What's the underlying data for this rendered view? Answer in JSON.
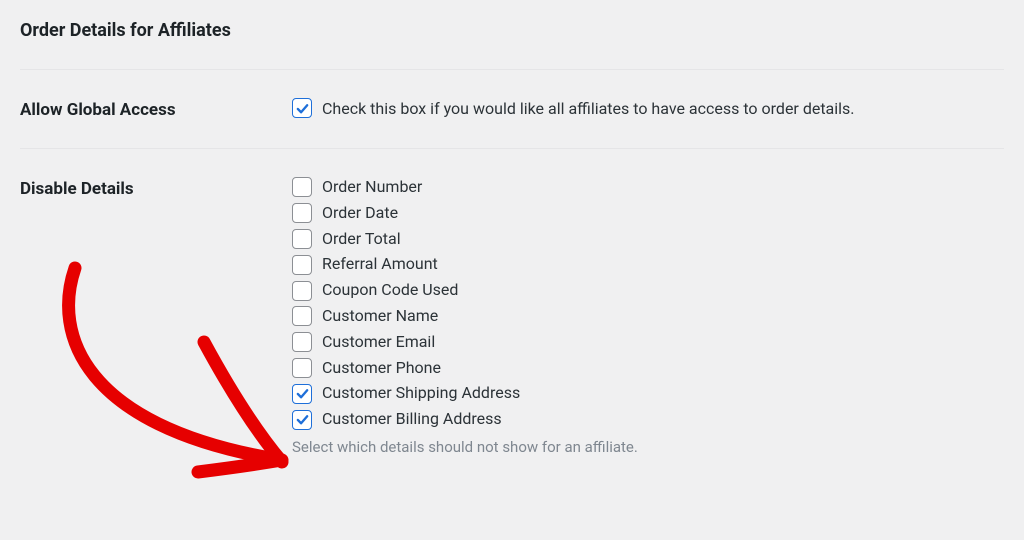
{
  "section_title": "Order Details for Affiliates",
  "allow_global": {
    "label": "Allow Global Access",
    "checked": true,
    "description": "Check this box if you would like all affiliates to have access to order details."
  },
  "disable_details": {
    "label": "Disable Details",
    "help": "Select which details should not show for an affiliate.",
    "options": [
      {
        "name": "order-number",
        "label": "Order Number",
        "checked": false
      },
      {
        "name": "order-date",
        "label": "Order Date",
        "checked": false
      },
      {
        "name": "order-total",
        "label": "Order Total",
        "checked": false
      },
      {
        "name": "referral-amount",
        "label": "Referral Amount",
        "checked": false
      },
      {
        "name": "coupon-code-used",
        "label": "Coupon Code Used",
        "checked": false
      },
      {
        "name": "customer-name",
        "label": "Customer Name",
        "checked": false
      },
      {
        "name": "customer-email",
        "label": "Customer Email",
        "checked": false
      },
      {
        "name": "customer-phone",
        "label": "Customer Phone",
        "checked": false
      },
      {
        "name": "customer-shipping-address",
        "label": "Customer Shipping Address",
        "checked": true
      },
      {
        "name": "customer-billing-address",
        "label": "Customer Billing Address",
        "checked": true
      }
    ]
  },
  "colors": {
    "check_blue": "#1e6fd9",
    "annotation_red": "#e60000"
  }
}
